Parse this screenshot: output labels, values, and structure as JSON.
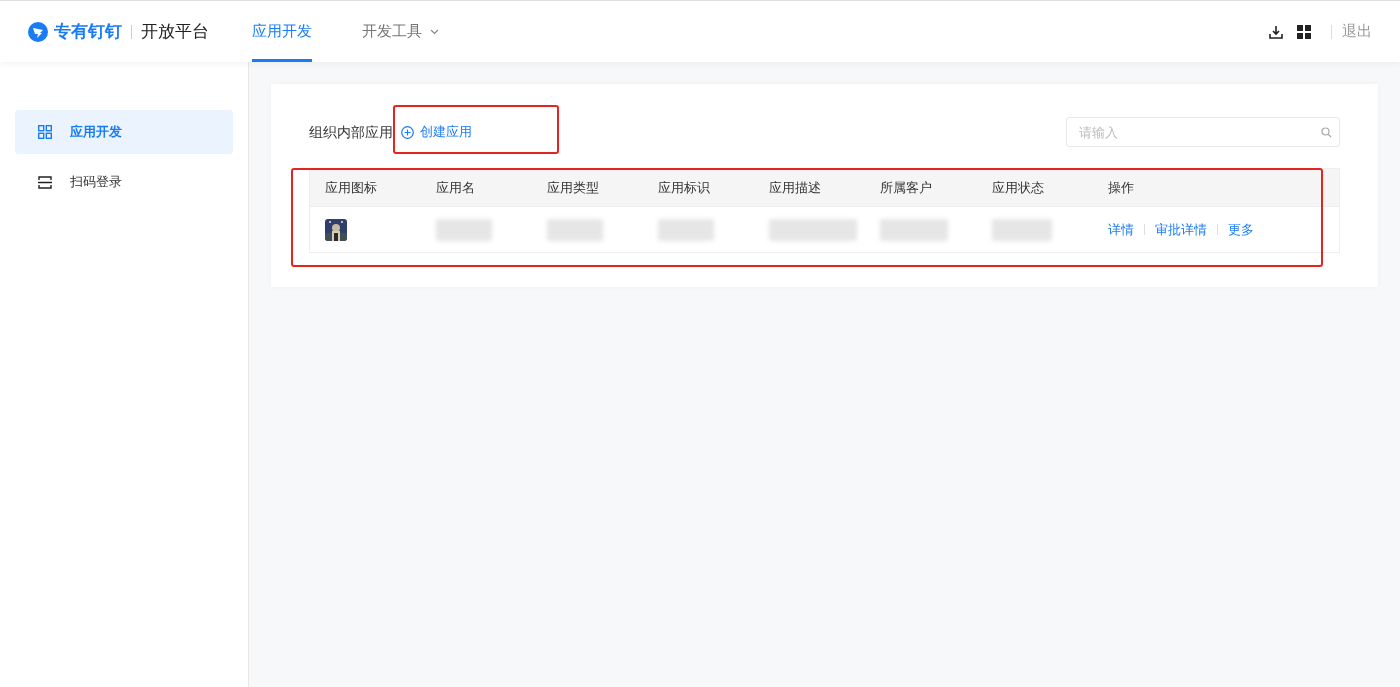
{
  "header": {
    "brand": "专有钉钉",
    "platform": "开放平台",
    "nav": [
      {
        "label": "应用开发",
        "selected": true,
        "dropdown": false
      },
      {
        "label": "开发工具",
        "selected": false,
        "dropdown": true
      }
    ],
    "logout": "退出"
  },
  "sidebar": {
    "items": [
      {
        "label": "应用开发",
        "selected": true,
        "kind": "grid"
      },
      {
        "label": "扫码登录",
        "selected": false,
        "kind": "scan"
      }
    ]
  },
  "section": {
    "title": "组织内部应用",
    "create_button": "创建应用",
    "search": {
      "placeholder": "请输入"
    }
  },
  "table": {
    "columns": [
      "应用图标",
      "应用名",
      "应用类型",
      "应用标识",
      "应用描述",
      "所属客户",
      "应用状态",
      "操作"
    ],
    "rows": [
      {
        "actions": [
          "详情",
          "审批详情",
          "更多"
        ]
      }
    ]
  }
}
